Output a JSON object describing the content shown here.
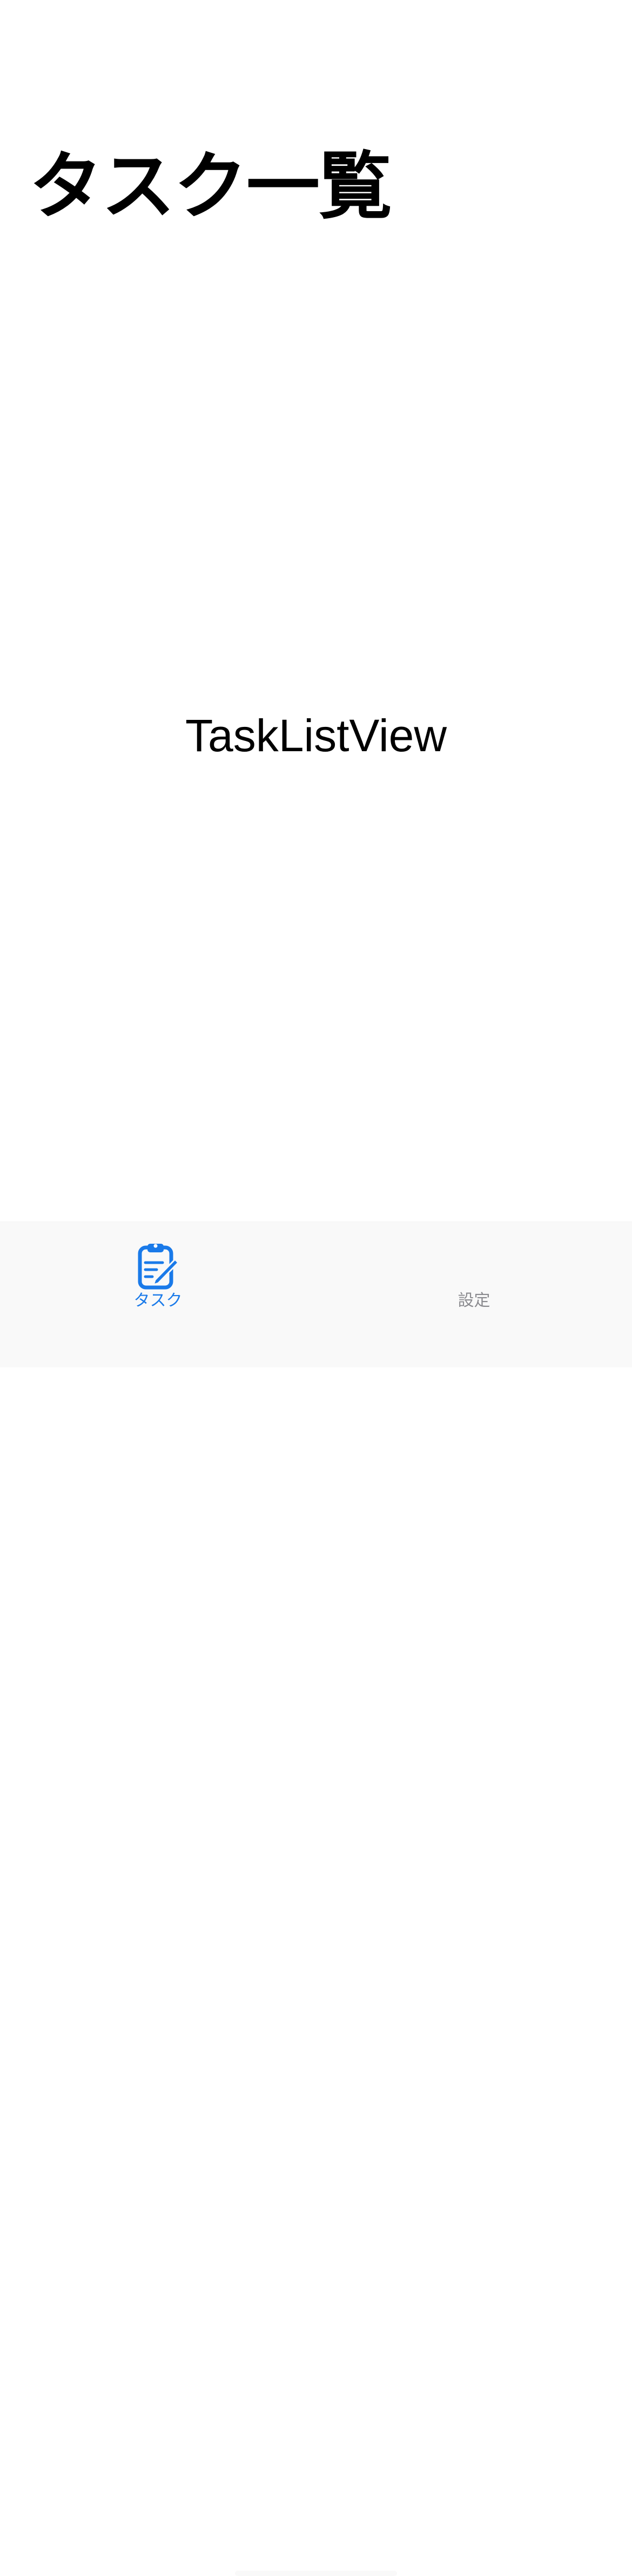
{
  "app": {
    "accent_color": "#1a7ae9",
    "inactive_color": "#8b8b8f",
    "background_color": "#ffffff",
    "tab_bar_color": "#f9f9f9"
  },
  "navigation": {
    "title": "タスク一覧"
  },
  "content": {
    "placeholder_text": "TaskListView"
  },
  "tab_bar": {
    "tabs": [
      {
        "label": "タスク",
        "icon": "clipboard-pencil-icon",
        "selected": true
      },
      {
        "label": "設定",
        "icon": "",
        "selected": false
      }
    ]
  }
}
